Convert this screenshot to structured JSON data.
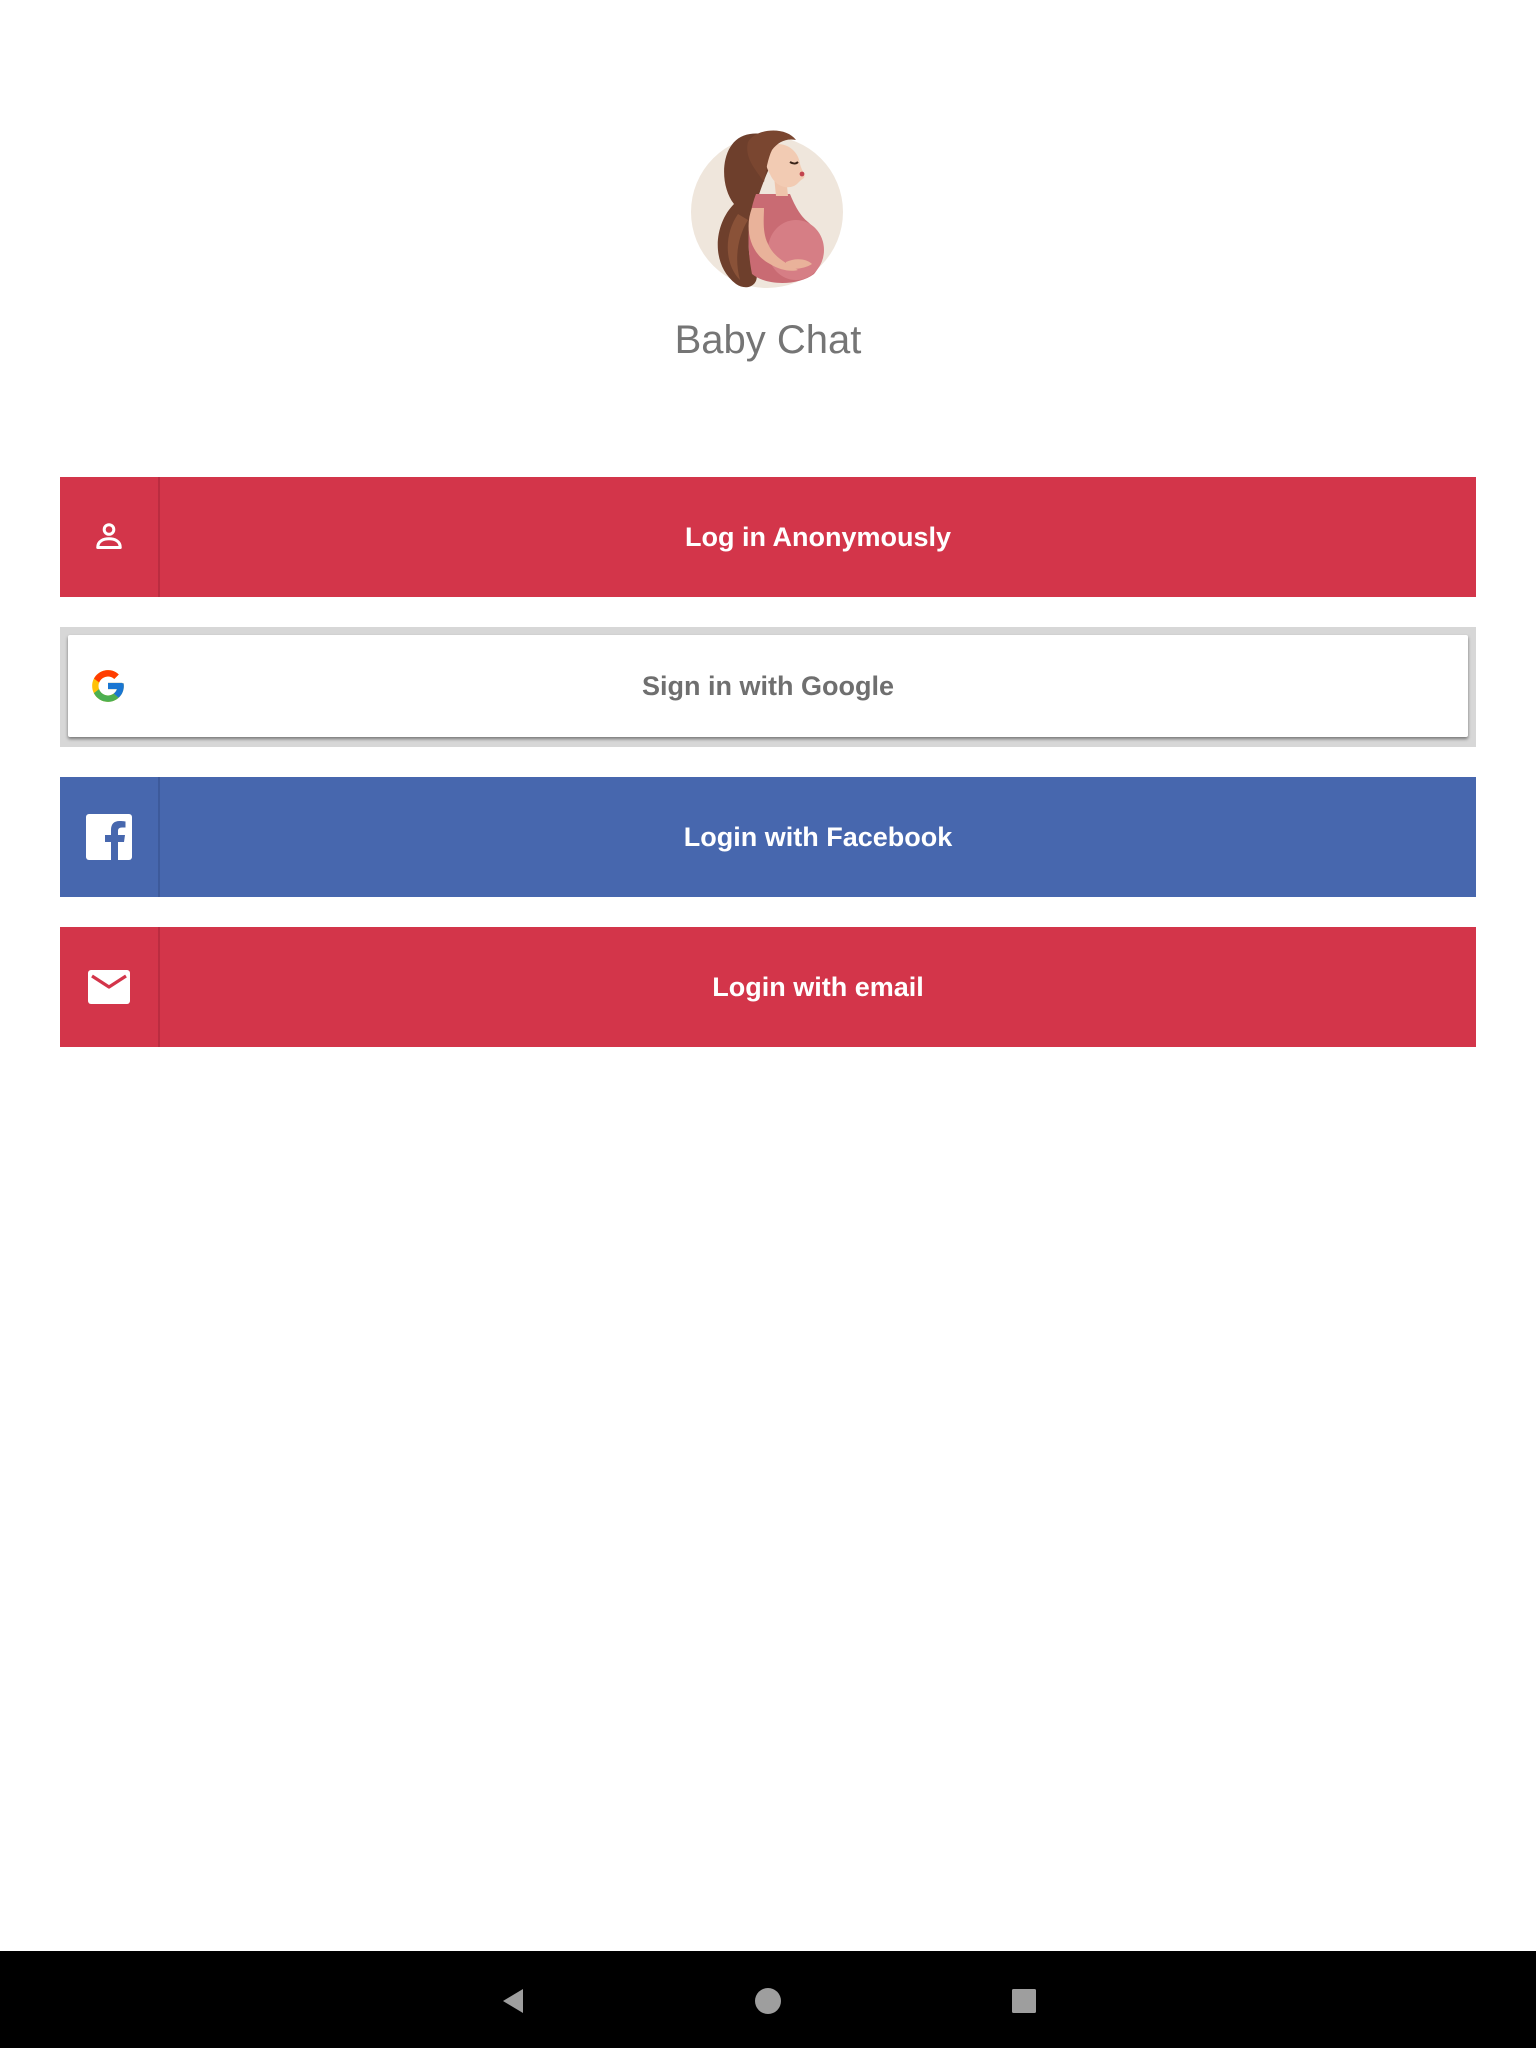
{
  "app": {
    "title": "Baby Chat",
    "logo_icon": "pregnant-woman-illustration"
  },
  "buttons": {
    "anonymous": {
      "label": "Log in Anonymously",
      "icon": "person-icon",
      "color": "#d3354a"
    },
    "google": {
      "label": "Sign in with Google",
      "icon": "google-icon",
      "color": "#ffffff"
    },
    "facebook": {
      "label": "Login with Facebook",
      "icon": "facebook-icon",
      "color": "#4767ae"
    },
    "email": {
      "label": "Login with email",
      "icon": "email-icon",
      "color": "#d3354a"
    }
  },
  "navbar": {
    "items": [
      {
        "icon": "back-icon"
      },
      {
        "icon": "home-icon"
      },
      {
        "icon": "recents-icon"
      }
    ]
  }
}
